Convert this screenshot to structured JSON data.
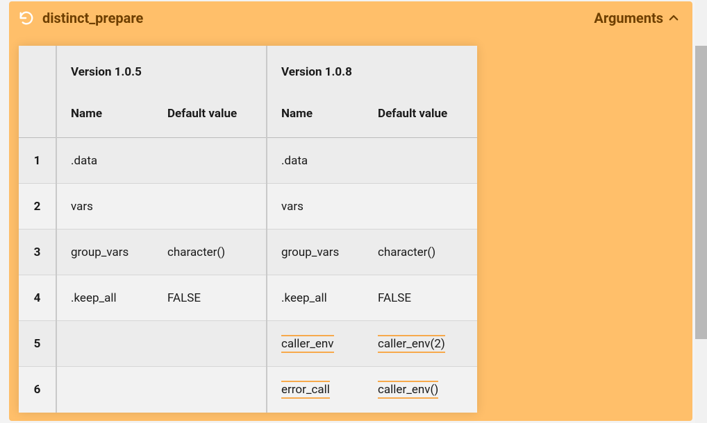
{
  "header": {
    "title": "distinct_prepare",
    "toggle_label": "Arguments"
  },
  "versions": {
    "left": {
      "label": "Version 1.0.5"
    },
    "right": {
      "label": "Version 1.0.8"
    }
  },
  "columns": {
    "name": "Name",
    "default": "Default value"
  },
  "rows": [
    {
      "idx": "1",
      "left": {
        "name": ".data",
        "default": ""
      },
      "right": {
        "name": ".data",
        "default": ""
      },
      "hl": false
    },
    {
      "idx": "2",
      "left": {
        "name": "vars",
        "default": ""
      },
      "right": {
        "name": "vars",
        "default": ""
      },
      "hl": false
    },
    {
      "idx": "3",
      "left": {
        "name": "group_vars",
        "default": "character()"
      },
      "right": {
        "name": "group_vars",
        "default": "character()"
      },
      "hl": false
    },
    {
      "idx": "4",
      "left": {
        "name": ".keep_all",
        "default": "FALSE"
      },
      "right": {
        "name": ".keep_all",
        "default": "FALSE"
      },
      "hl": false
    },
    {
      "idx": "5",
      "left": {
        "name": "",
        "default": ""
      },
      "right": {
        "name": "caller_env",
        "default": "caller_env(2)"
      },
      "hl": true
    },
    {
      "idx": "6",
      "left": {
        "name": "",
        "default": ""
      },
      "right": {
        "name": "error_call",
        "default": "caller_env()"
      },
      "hl": true
    }
  ]
}
